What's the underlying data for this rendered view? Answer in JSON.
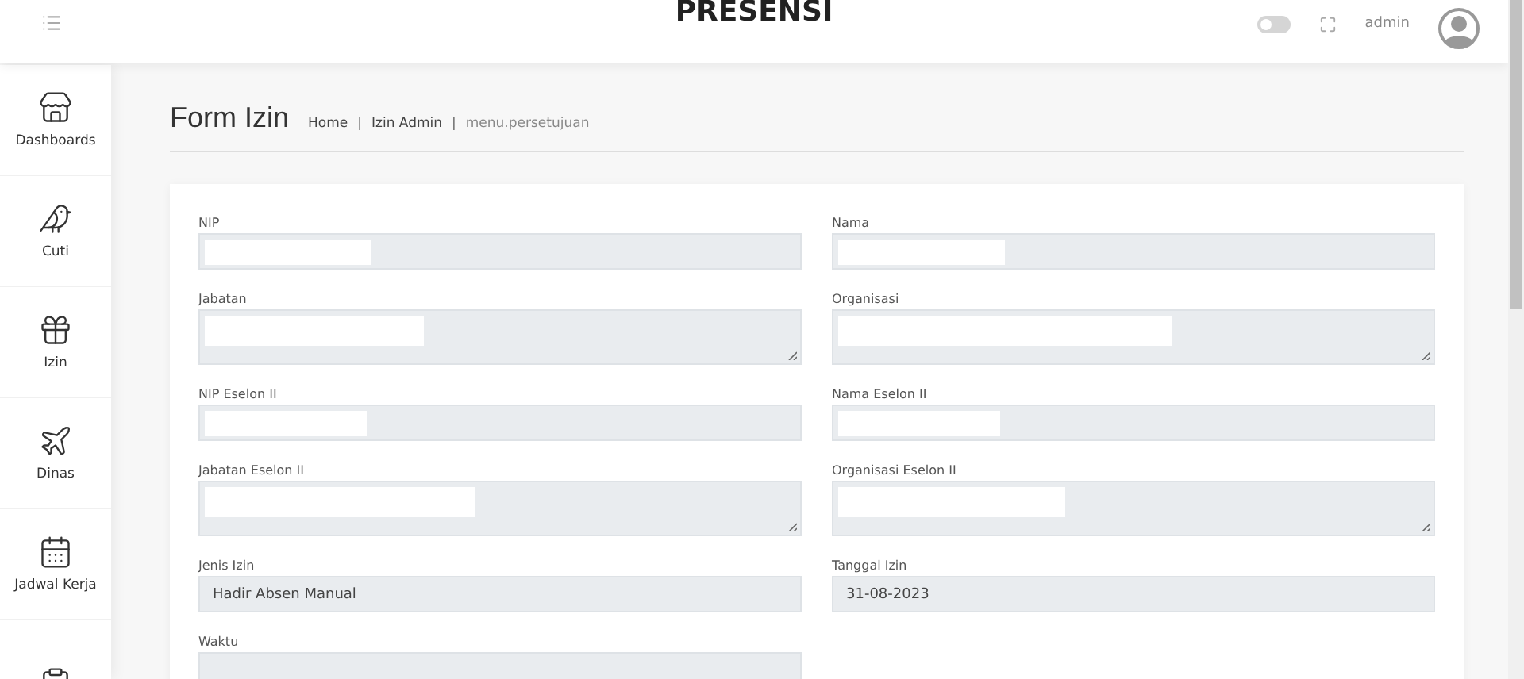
{
  "header": {
    "title": "PRESENSI",
    "theme_toggle": {
      "on": false
    },
    "user": "admin"
  },
  "sidebar": {
    "items": [
      {
        "label": "Dashboards",
        "selected": false
      },
      {
        "label": "Cuti",
        "selected": false
      },
      {
        "label": "Izin",
        "selected": false
      },
      {
        "label": "Dinas",
        "selected": false
      },
      {
        "label": "Jadwal Kerja",
        "selected": false
      }
    ]
  },
  "page": {
    "title": "Form Izin",
    "breadcrumb": [
      "Home",
      "Izin Admin",
      "menu.persetujuan"
    ],
    "breadcrumb_separator": "|"
  },
  "form": {
    "fields": [
      {
        "label": "NIP",
        "kind": "input",
        "redacted": true
      },
      {
        "label": "Nama",
        "kind": "input",
        "redacted": true
      },
      {
        "label": "Jabatan",
        "kind": "textarea",
        "redacted": true
      },
      {
        "label": "Organisasi",
        "kind": "textarea",
        "redacted": true
      },
      {
        "label": "NIP Eselon II",
        "kind": "input",
        "redacted": true
      },
      {
        "label": "Nama Eselon II",
        "kind": "input",
        "redacted": true
      },
      {
        "label": "Jabatan Eselon II",
        "kind": "textarea",
        "redacted": true
      },
      {
        "label": "Organisasi Eselon II",
        "kind": "textarea",
        "redacted": true
      },
      {
        "label": "Jenis Izin",
        "kind": "input",
        "value": "Hadir Absen Manual",
        "redacted": false
      },
      {
        "label": "Tanggal Izin",
        "kind": "input",
        "value": "31-08-2023",
        "redacted": false
      },
      {
        "label": "Waktu",
        "kind": "input",
        "redacted": false
      }
    ]
  }
}
